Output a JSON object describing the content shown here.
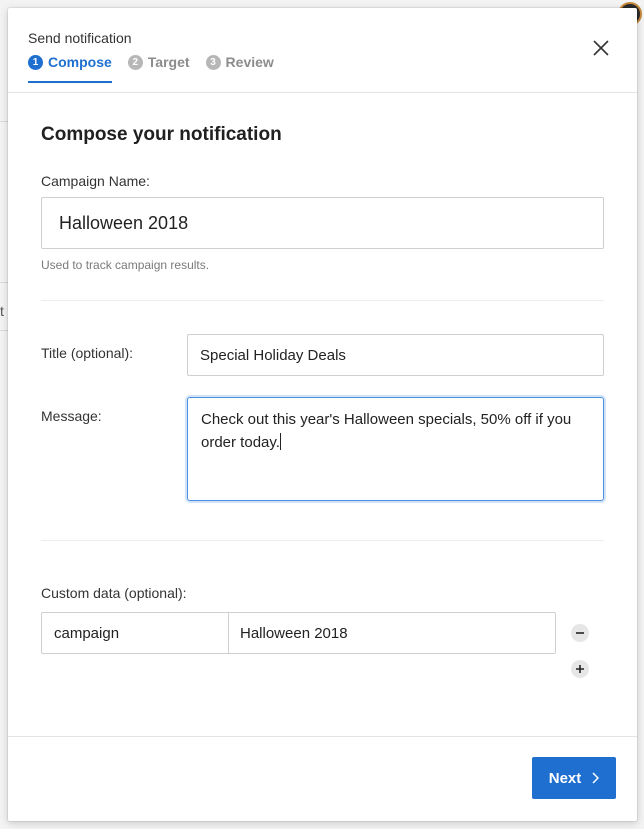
{
  "modal": {
    "title": "Send notification",
    "steps": [
      {
        "num": "1",
        "label": "Compose"
      },
      {
        "num": "2",
        "label": "Target"
      },
      {
        "num": "3",
        "label": "Review"
      }
    ],
    "active_step": "Compose"
  },
  "compose": {
    "heading": "Compose your notification",
    "campaign_name_label": "Campaign Name:",
    "campaign_name_value": "Halloween 2018",
    "campaign_name_hint": "Used to track campaign results.",
    "title_label": "Title (optional):",
    "title_value": "Special Holiday Deals",
    "message_label": "Message:",
    "message_value": "Check out this year's Halloween specials, 50% off if you order today.",
    "custom_data_label": "Custom data (optional):",
    "custom_data": [
      {
        "key": "campaign",
        "value": "Halloween 2018"
      }
    ]
  },
  "footer": {
    "next_label": "Next"
  },
  "background": {
    "partial_char": "t"
  },
  "colors": {
    "accent": "#1e6fcf",
    "focus_border": "#4a90e2"
  },
  "icons": [
    "close-icon",
    "remove-row-icon",
    "add-row-icon",
    "chevron-right-icon",
    "avatar"
  ]
}
